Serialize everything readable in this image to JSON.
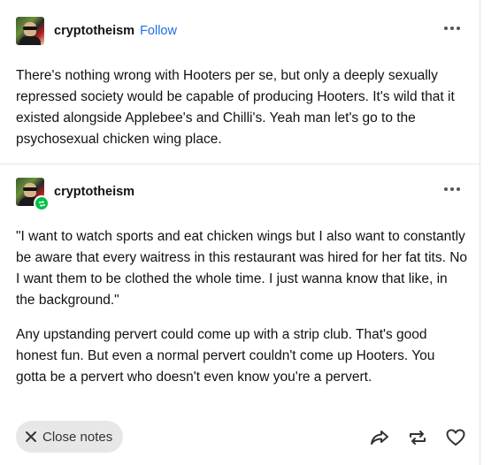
{
  "posts": [
    {
      "username": "cryptotheism",
      "follow_label": "Follow",
      "paragraphs": [
        "There's nothing wrong with Hooters per se, but only a deeply sexually repressed society would be capable of producing Hooters. It's wild that it existed alongside Applebee's and Chilli's. Yeah man let's go to the psychosexual chicken wing place."
      ]
    },
    {
      "username": "cryptotheism",
      "paragraphs": [
        "\"I want to watch sports and eat chicken wings but I also want to constantly be aware that every waitress in this restaurant was hired for her fat tits. No I want them to be clothed the whole time. I just wanna know that like, in the background.\"",
        "Any upstanding pervert could come up with a strip club. That's good honest fun. But even a normal pervert couldn't come up Hooters. You gotta be a pervert who doesn't even know you're a pervert."
      ]
    }
  ],
  "footer": {
    "close_notes_label": "Close notes",
    "icons": [
      "close-icon",
      "share-icon",
      "reblog-icon",
      "like-icon"
    ]
  },
  "colors": {
    "follow": "#1d6ee8",
    "reblog_badge": "#01c14a",
    "pill_bg": "#e7e7e7"
  }
}
